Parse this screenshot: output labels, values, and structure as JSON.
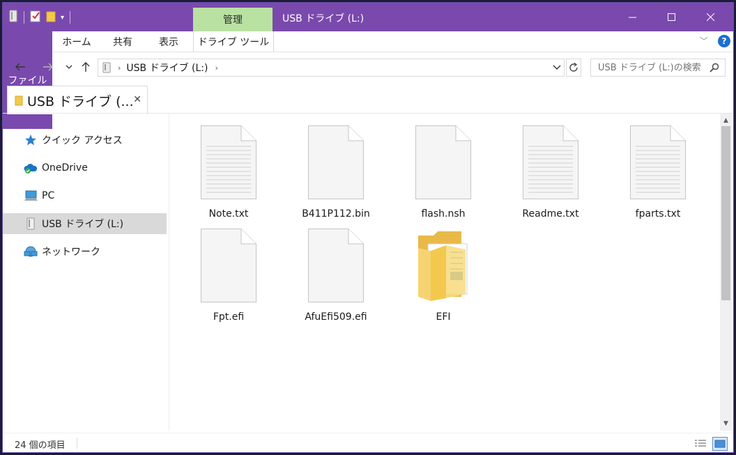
{
  "window": {
    "title": "USB ドライブ (L:)",
    "context_tab": "管理",
    "controls": {
      "minimize": "—",
      "maximize": "☐",
      "close": "✕"
    }
  },
  "ribbon": {
    "tabs": [
      "ファイル",
      "ホーム",
      "共有",
      "表示",
      "ドライブ ツール"
    ],
    "help": "?"
  },
  "address": {
    "path": "USB ドライブ (L:)"
  },
  "search": {
    "placeholder": "USB ドライブ (L:)の検索"
  },
  "doc_tab": {
    "title": "USB ドライブ (..."
  },
  "nav": {
    "items": [
      {
        "label": "クイック アクセス",
        "icon": "star-icon"
      },
      {
        "label": "OneDrive",
        "icon": "cloud-icon"
      },
      {
        "label": "PC",
        "icon": "computer-icon"
      },
      {
        "label": "USB ドライブ (L:)",
        "icon": "usb-drive-icon",
        "selected": true
      },
      {
        "label": "ネットワーク",
        "icon": "network-icon"
      }
    ]
  },
  "files": [
    {
      "name": "Note.txt",
      "type": "text"
    },
    {
      "name": "B411P112.bin",
      "type": "blank"
    },
    {
      "name": "flash.nsh",
      "type": "blank"
    },
    {
      "name": "Readme.txt",
      "type": "text"
    },
    {
      "name": "fparts.txt",
      "type": "text"
    },
    {
      "name": "Fpt.efi",
      "type": "blank"
    },
    {
      "name": "AfuEfi509.efi",
      "type": "blank"
    },
    {
      "name": "EFI",
      "type": "folder"
    }
  ],
  "status": {
    "count": "24 個の項目"
  },
  "colors": {
    "titlebar": "#7a49ad",
    "manage_tab": "#b9e2a2",
    "selection": "#d9d9d9",
    "folder": "#f2c94c"
  }
}
